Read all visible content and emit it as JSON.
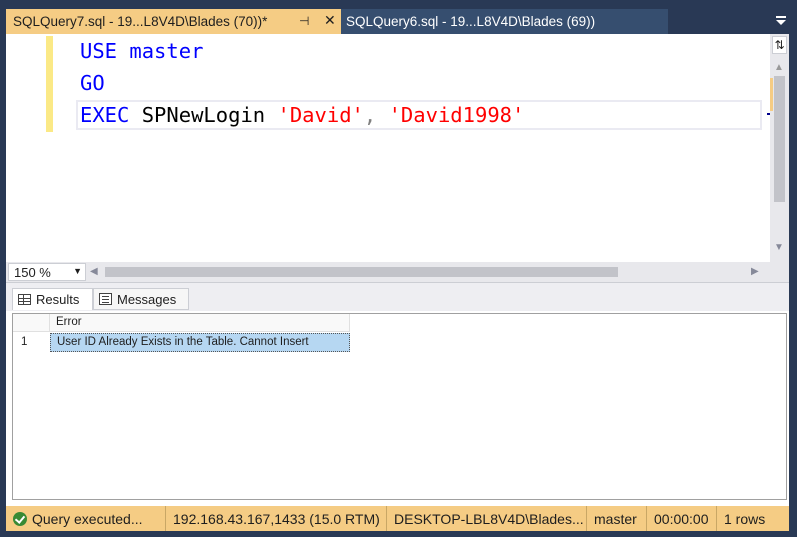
{
  "tabs": {
    "active": {
      "label": "SQLQuery7.sql - 19...L8V4D\\Blades (70))*",
      "pin": "⊣",
      "close": "✕"
    },
    "inactive": {
      "label": "SQLQuery6.sql - 19...L8V4D\\Blades (69))"
    }
  },
  "editor": {
    "lines": [
      {
        "kw1": "USE",
        "rest": " master"
      },
      {
        "kw1": "GO"
      },
      {
        "kw1": "EXEC",
        "proc": " SPNewLogin ",
        "arg1": "'David'",
        "comma": ", ",
        "arg2": "'David1998'"
      }
    ],
    "split_glyph": "⇅"
  },
  "zoom": {
    "value": "150 %"
  },
  "results": {
    "tabs": {
      "results": "Results",
      "messages": "Messages"
    },
    "columns": [
      "Error"
    ],
    "rows": [
      {
        "num": "1",
        "cells": [
          "User ID Already Exists in the Table. Cannot Insert"
        ]
      }
    ]
  },
  "status": {
    "query": "Query executed...",
    "server": "192.168.43.167,1433 (15.0 RTM)",
    "login": "DESKTOP-LBL8V4D\\Blades...",
    "database": "master",
    "elapsed": "00:00:00",
    "rows": "1 rows"
  },
  "colors": {
    "chrome": "#293955",
    "active_tab": "#f5cc84",
    "inactive_tab": "#364e6f",
    "keyword": "#0000ff",
    "string": "#ff0000",
    "selection": "#b6d7f2",
    "status_bar": "#f5cc84",
    "success": "#388a34"
  },
  "icons": [
    "pin-icon",
    "close-icon",
    "dropdown-icon",
    "split-icon",
    "grid-icon",
    "messages-icon",
    "success-icon"
  ]
}
